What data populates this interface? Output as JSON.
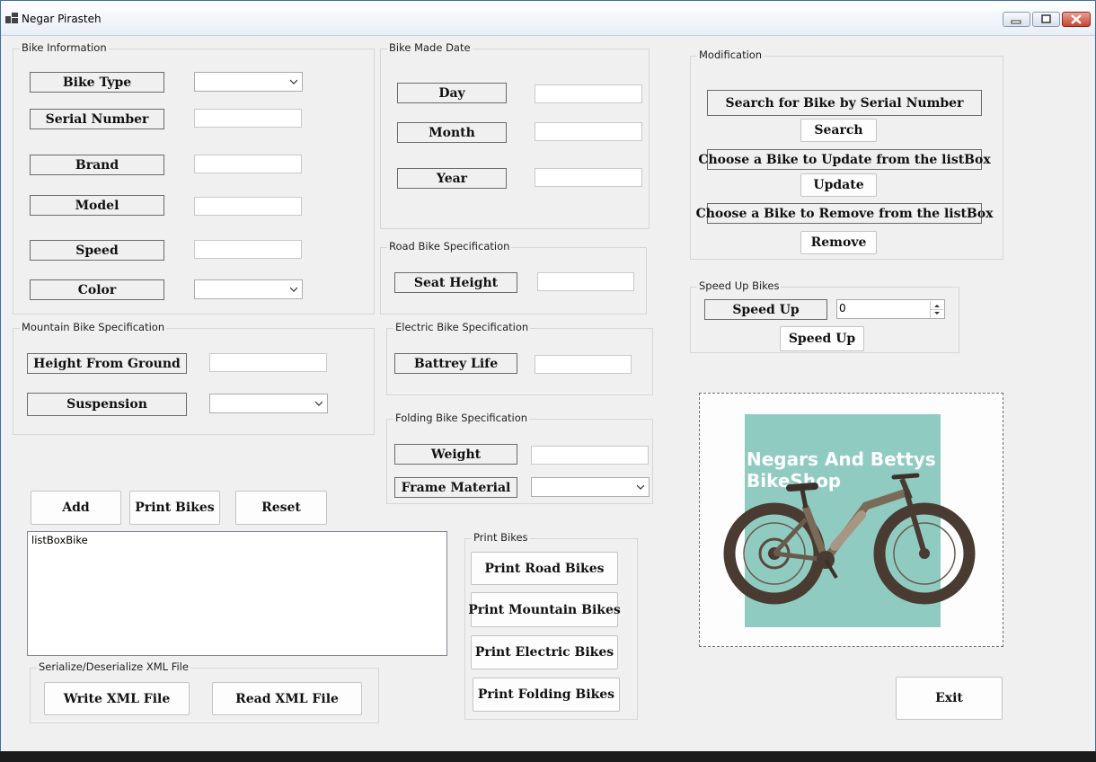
{
  "window": {
    "title": "Negar Pirasteh"
  },
  "bike_info": {
    "group_title": "Bike Information",
    "bike_type_label": "Bike Type",
    "serial_number_label": "Serial Number",
    "brand_label": "Brand",
    "model_label": "Model",
    "speed_label": "Speed",
    "color_label": "Color"
  },
  "made_date": {
    "group_title": "Bike Made Date",
    "day_label": "Day",
    "month_label": "Month",
    "year_label": "Year"
  },
  "road_spec": {
    "group_title": "Road Bike Specification",
    "seat_height_label": "Seat Height"
  },
  "mountain_spec": {
    "group_title": "Mountain Bike Specification",
    "height_label": "Height From Ground",
    "suspension_label": "Suspension"
  },
  "electric_spec": {
    "group_title": "Electric Bike Specification",
    "battery_label": "Battrey Life"
  },
  "folding_spec": {
    "group_title": "Folding Bike Specification",
    "weight_label": "Weight",
    "frame_material_label": "Frame Material"
  },
  "actions": {
    "add": "Add",
    "print_bikes": "Print Bikes",
    "reset": "Reset"
  },
  "listbox": {
    "text": "listBoxBike"
  },
  "xml": {
    "group_title": "Serialize/Deserialize XML File",
    "write": "Write XML File",
    "read": "Read XML File"
  },
  "print_group": {
    "group_title": "Print Bikes",
    "road": "Print Road Bikes",
    "mountain": "Print Mountain Bikes",
    "electric": "Print Electric Bikes",
    "folding": "Print Folding Bikes"
  },
  "modification": {
    "group_title": "Modification",
    "search_label": "Search for Bike by Serial Number",
    "search_button": "Search",
    "update_label": "Choose a Bike to Update from the listBox",
    "update_button": "Update",
    "remove_label": "Choose a Bike to Remove from the listBox",
    "remove_button": "Remove"
  },
  "speed_up": {
    "group_title": "Speed Up Bikes",
    "label": "Speed Up",
    "value": "0",
    "button": "Speed Up"
  },
  "logo": {
    "line1": "Negars And Bettys",
    "line2": "BikeShop",
    "panel_color": "#90cbc1"
  },
  "exit": "Exit",
  "icons": [
    "app-icon",
    "minimize-icon",
    "maximize-icon",
    "close-icon",
    "chevron-down-icon",
    "spin-up-icon",
    "spin-down-icon",
    "bicycle-image"
  ]
}
